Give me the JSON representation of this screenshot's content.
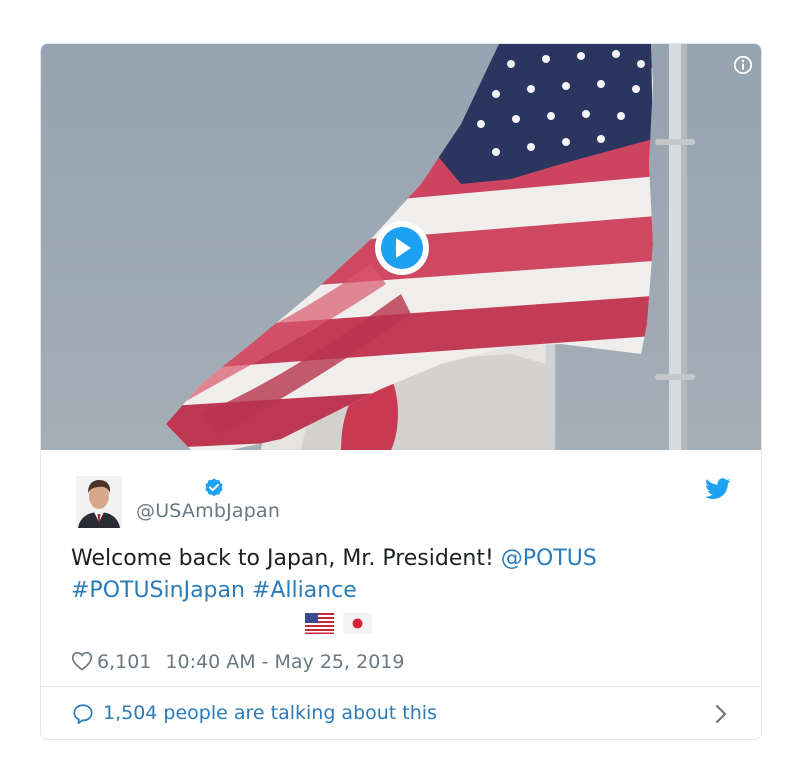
{
  "tweet": {
    "handle": "@USAmbJapan",
    "text_plain": "Welcome back to Japan, Mr. President! ",
    "mention": "@POTUS",
    "hashtag_1": "#POTUSinJapan",
    "hashtag_2": "#Alliance",
    "flag_1": "flag-usa",
    "flag_2": "flag-japan",
    "like_count": "6,101",
    "timestamp": "10:40 AM - May 25, 2019",
    "talking_text": "1,504 people are talking about this"
  },
  "icons": {
    "info": "info-icon",
    "play": "play-icon",
    "verified": "verified-badge-icon",
    "twitter": "twitter-bird-icon",
    "heart": "heart-icon",
    "bubble": "speech-bubble-icon",
    "chevron": "chevron-right-icon"
  },
  "colors": {
    "link": "#2b7bb9",
    "text": "#1c2022",
    "muted": "#697882",
    "twitter_blue": "#1da1f2",
    "border": "#e1e8ed"
  }
}
